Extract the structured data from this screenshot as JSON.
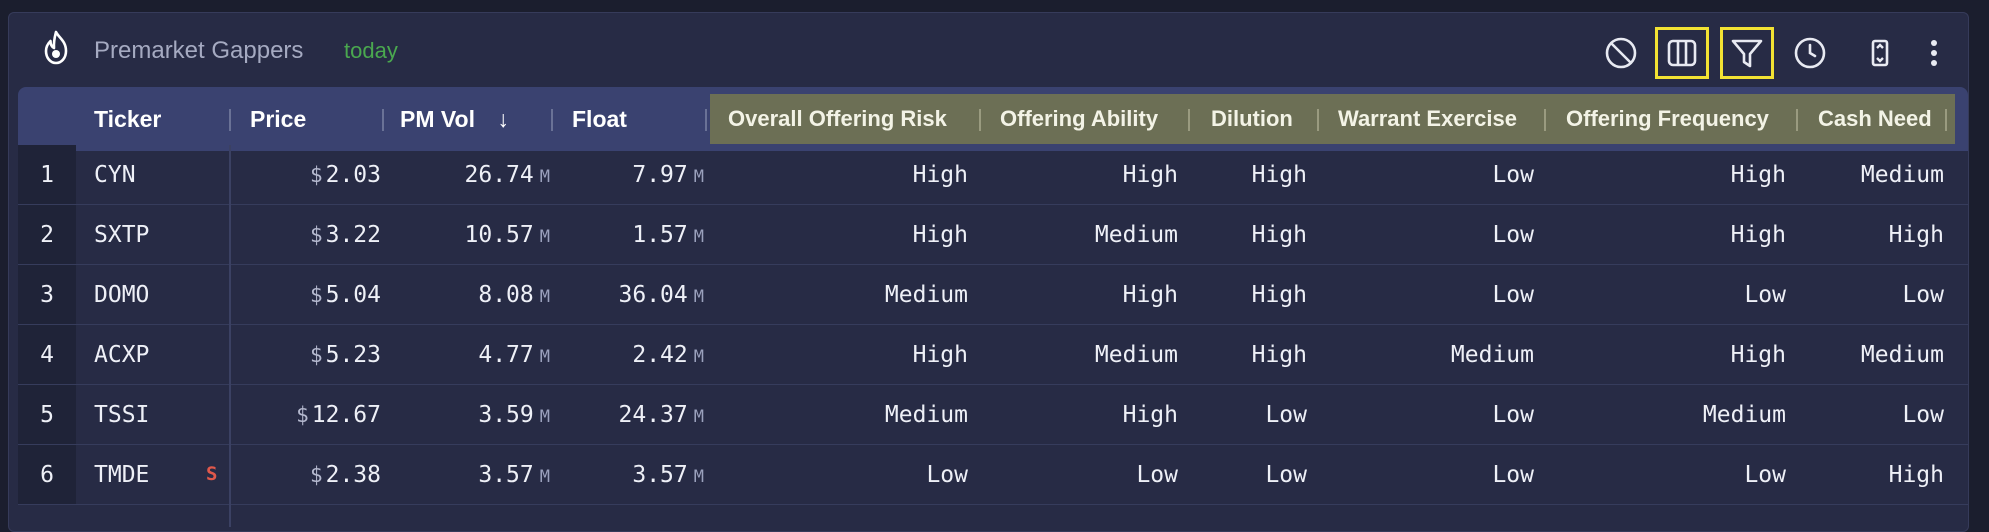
{
  "header": {
    "title": "Premarket Gappers",
    "subtitle": "today",
    "icons": [
      "fire-logo-icon",
      "block-icon",
      "columns-icon",
      "filter-icon",
      "clock-icon",
      "expand-icon",
      "more-icon"
    ]
  },
  "colors": {
    "accent_green": "#4aa84f",
    "highlight": "#f2e233",
    "risk_band": "#6c6f55",
    "short_badge": "#e0584b"
  },
  "table": {
    "columns": {
      "ticker": "Ticker",
      "price": "Price",
      "pm_vol": "PM Vol",
      "sort_indicator": "↓",
      "float": "Float",
      "overall_risk": "Overall Offering Risk",
      "offering_ability": "Offering Ability",
      "dilution": "Dilution",
      "warrant_exercise": "Warrant Exercise",
      "offering_frequency": "Offering Frequency",
      "cash_need": "Cash Need"
    },
    "currency": "$",
    "unit": "M",
    "rows": [
      {
        "idx": "1",
        "ticker": "CYN",
        "badge": "",
        "price": "2.03",
        "pm_vol": "26.74",
        "float": "7.97",
        "overall": "High",
        "ability": "High",
        "dilution": "High",
        "warrant": "Low",
        "frequency": "High",
        "cash": "Medium"
      },
      {
        "idx": "2",
        "ticker": "SXTP",
        "badge": "",
        "price": "3.22",
        "pm_vol": "10.57",
        "float": "1.57",
        "overall": "High",
        "ability": "Medium",
        "dilution": "High",
        "warrant": "Low",
        "frequency": "High",
        "cash": "High"
      },
      {
        "idx": "3",
        "ticker": "DOMO",
        "badge": "",
        "price": "5.04",
        "pm_vol": "8.08",
        "float": "36.04",
        "overall": "Medium",
        "ability": "High",
        "dilution": "High",
        "warrant": "Low",
        "frequency": "Low",
        "cash": "Low"
      },
      {
        "idx": "4",
        "ticker": "ACXP",
        "badge": "",
        "price": "5.23",
        "pm_vol": "4.77",
        "float": "2.42",
        "overall": "High",
        "ability": "Medium",
        "dilution": "High",
        "warrant": "Medium",
        "frequency": "High",
        "cash": "Medium"
      },
      {
        "idx": "5",
        "ticker": "TSSI",
        "badge": "",
        "price": "12.67",
        "pm_vol": "3.59",
        "float": "24.37",
        "overall": "Medium",
        "ability": "High",
        "dilution": "Low",
        "warrant": "Low",
        "frequency": "Medium",
        "cash": "Low"
      },
      {
        "idx": "6",
        "ticker": "TMDE",
        "badge": "S",
        "price": "2.38",
        "pm_vol": "3.57",
        "float": "3.57",
        "overall": "Low",
        "ability": "Low",
        "dilution": "Low",
        "warrant": "Low",
        "frequency": "Low",
        "cash": "High"
      }
    ]
  }
}
